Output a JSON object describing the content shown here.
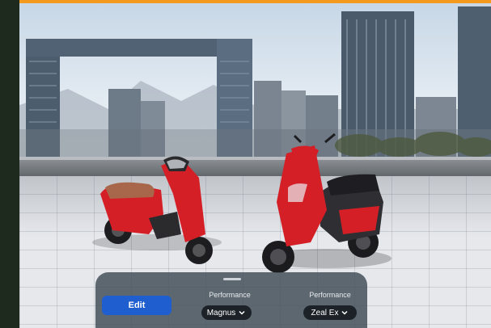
{
  "panel": {
    "edit_label": "Edit",
    "left": {
      "heading": "Performance",
      "selected": "Magnus"
    },
    "right": {
      "heading": "Performance",
      "selected": "Zeal Ex"
    }
  },
  "icons": {
    "dropdown": "chevron-down-icon"
  },
  "colors": {
    "accent_bar": "#f39a1e",
    "edit_button": "#1f5ecf",
    "scooter_red": "#d41f26",
    "panel": "#4a545f"
  }
}
